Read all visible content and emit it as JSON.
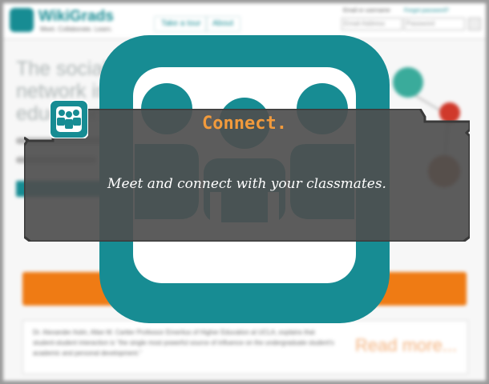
{
  "background_page": {
    "brand": "WikiGrads",
    "tagline": "Meet. Collaborate. Learn.",
    "nav": [
      "Take a tour",
      "About"
    ],
    "login": {
      "email_label": "Email or username",
      "forgot_label": "Forgot password?",
      "email_placeholder": "Email Address",
      "password_placeholder": "Password"
    },
    "hero_heading": "The social learning network in higher education",
    "quote": "Dr. Alexander Astin, Allan M. Cartter Professor Emeritus of Higher Education at UCLA, explains that student-student interaction is \"the single most powerful source of influence on the undergraduate student's academic and personal development.\"",
    "read_more": "Read more..."
  },
  "overlay": {
    "title": "Connect.",
    "text": "Meet and connect with your classmates."
  },
  "colors": {
    "teal": "#178c93",
    "panel_gray": "#595959",
    "title_orange": "#f29a3c",
    "cta_orange": "#ef7b14"
  },
  "icons": {
    "big": "people-group-icon",
    "small": "people-group-icon"
  }
}
